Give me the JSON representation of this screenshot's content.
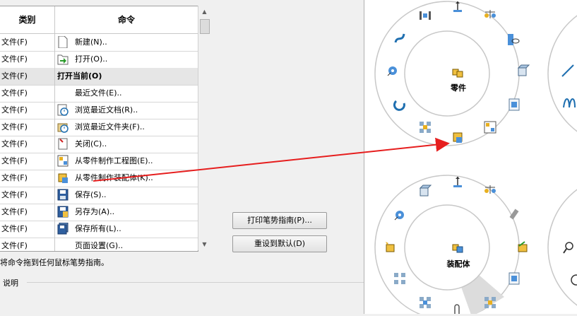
{
  "table": {
    "header": {
      "category": "类别",
      "command": "命令"
    },
    "rows": [
      {
        "category": "文件(F)",
        "command": "新建(N)..",
        "icon": "new-document-icon"
      },
      {
        "category": "文件(F)",
        "command": "打开(O)..",
        "icon": "open-icon"
      },
      {
        "category": "文件(F)",
        "command": "打开当前(O)",
        "icon": ""
      },
      {
        "category": "文件(F)",
        "command": "最近文件(E)..",
        "icon": ""
      },
      {
        "category": "文件(F)",
        "command": "浏览最近文档(R)..",
        "icon": "browse-recent-documents-icon"
      },
      {
        "category": "文件(F)",
        "command": "浏览最近文件夹(F)..",
        "icon": "browse-recent-folders-icon"
      },
      {
        "category": "文件(F)",
        "command": "关闭(C)..",
        "icon": "close-document-icon"
      },
      {
        "category": "文件(F)",
        "command": "从零件制作工程图(E)..",
        "icon": "make-drawing-icon"
      },
      {
        "category": "文件(F)",
        "command": "从零件制作装配体(K)..",
        "icon": "make-assembly-icon"
      },
      {
        "category": "文件(F)",
        "command": "保存(S)..",
        "icon": "save-icon"
      },
      {
        "category": "文件(F)",
        "command": "另存为(A)..",
        "icon": "save-as-icon"
      },
      {
        "category": "文件(F)",
        "command": "保存所有(L)..",
        "icon": "save-all-icon"
      },
      {
        "category": "文件(F)",
        "command": "页面设置(G)..",
        "icon": ""
      }
    ]
  },
  "hint": "将命令拖到任何鼠标笔势指南。",
  "description_label": "说明",
  "buttons": {
    "print_guide": "打印笔势指南(P)...",
    "reset_default": "重设到默认(D)"
  },
  "gesture_wheels": [
    {
      "label": "零件"
    },
    {
      "label": "装配体"
    }
  ],
  "colors": {
    "arrow": "#e61e1e",
    "selected_row": "#e6e6e6",
    "wheel_ring": "#c8c8c8"
  }
}
